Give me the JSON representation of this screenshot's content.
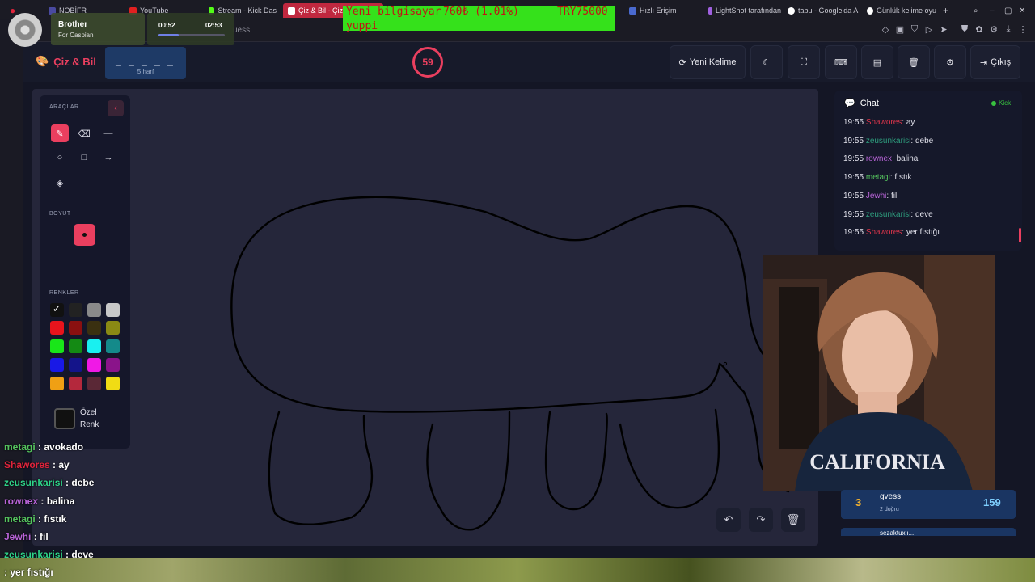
{
  "browser": {
    "tabs": [
      {
        "label": "NOBİFR",
        "color": "#4a4aa0"
      },
      {
        "label": "YouTube",
        "color": "#e02020"
      },
      {
        "label": "Stream - Kick Das",
        "color": "#53fc18"
      },
      {
        "label": "Çiz & Bil - Çizi",
        "color": "#ea3f5f"
      },
      {
        "label": "Hızlı Erişim",
        "color": "#4a6ad0"
      },
      {
        "label": "LightShot tarafından",
        "color": "#a060e0"
      },
      {
        "label": "tabu - Google'da A",
        "color": "#ffffff"
      },
      {
        "label": "Günlük kelime oyu",
        "color": "#ffffff"
      }
    ],
    "address_fragment": "uess"
  },
  "music_overlay": {
    "title": "Brother",
    "artist": "For Caspian",
    "elapsed": "00:52",
    "total": "02:53",
    "progress": 0.3
  },
  "donation_overlay": {
    "line1_a": "Yeni bilgisayar",
    "line1_b": "760₺ (1.01%)",
    "line1_c": "TRY75000",
    "line2": "yuppi"
  },
  "header": {
    "logo": "Çiz & Bil",
    "word_mask": "_ _ _ _ _",
    "word_hint": "5 harf",
    "timer": "59",
    "new_word_label": "Yeni Kelime",
    "exit_label": "Çıkış"
  },
  "tools_panel": {
    "tools_title": "ARAÇLAR",
    "size_title": "BOYUT",
    "colors_title": "RENKLER",
    "custom_color_label": "Özel Renk",
    "swatches": [
      "#111111",
      "#222222",
      "#8a8a8a",
      "#c8c8c8",
      "#e8141c",
      "#8a1010",
      "#3a3010",
      "#8a8a14",
      "#19e619",
      "#148a14",
      "#19f0f0",
      "#148a8a",
      "#1919e6",
      "#14148a",
      "#f019e6",
      "#8a148a",
      "#f0a014",
      "#b4283c",
      "#5a2836",
      "#f0dc14"
    ]
  },
  "chat": {
    "title": "Chat",
    "platform": "Kick",
    "messages": [
      {
        "time": "19:55",
        "user": "Shawores",
        "text": "ay",
        "color": "#d9344a"
      },
      {
        "time": "19:55",
        "user": "zeusunkarisi",
        "text": "debe",
        "color": "#2e9e7e"
      },
      {
        "time": "19:55",
        "user": "rownex",
        "text": "balina",
        "color": "#b964d8"
      },
      {
        "time": "19:55",
        "user": "metagi",
        "text": "fıstık",
        "color": "#55c45e"
      },
      {
        "time": "19:55",
        "user": "Jewhi",
        "text": "fil",
        "color": "#b964d8"
      },
      {
        "time": "19:55",
        "user": "zeusunkarisi",
        "text": "deve",
        "color": "#2e9e7e"
      },
      {
        "time": "19:55",
        "user": "Shawores",
        "text": "yer fıstığı",
        "color": "#d9344a"
      }
    ]
  },
  "leaderboard": {
    "rank": "3",
    "name": "gvess",
    "sub": "2 doğru",
    "score": "159",
    "next_name": "sezaktuxlı..."
  },
  "stream_chat": [
    {
      "user": "metagi",
      "text": "avokado",
      "color": "#55c45e"
    },
    {
      "user": "Shawores",
      "text": "ay",
      "color": "#e0243c"
    },
    {
      "user": "zeusunkarisi",
      "text": "debe",
      "color": "#2ed68a"
    },
    {
      "user": "rownex",
      "text": "balina",
      "color": "#b964d8"
    },
    {
      "user": "metagi",
      "text": "fıstık",
      "color": "#55c45e"
    },
    {
      "user": "Jewhi",
      "text": "fil",
      "color": "#b964d8"
    },
    {
      "user": "zeusunkarisi",
      "text": "deve",
      "color": "#2ed68a"
    },
    {
      "user": "",
      "text": "yer fıstığı",
      "color": "#e0243c"
    }
  ]
}
